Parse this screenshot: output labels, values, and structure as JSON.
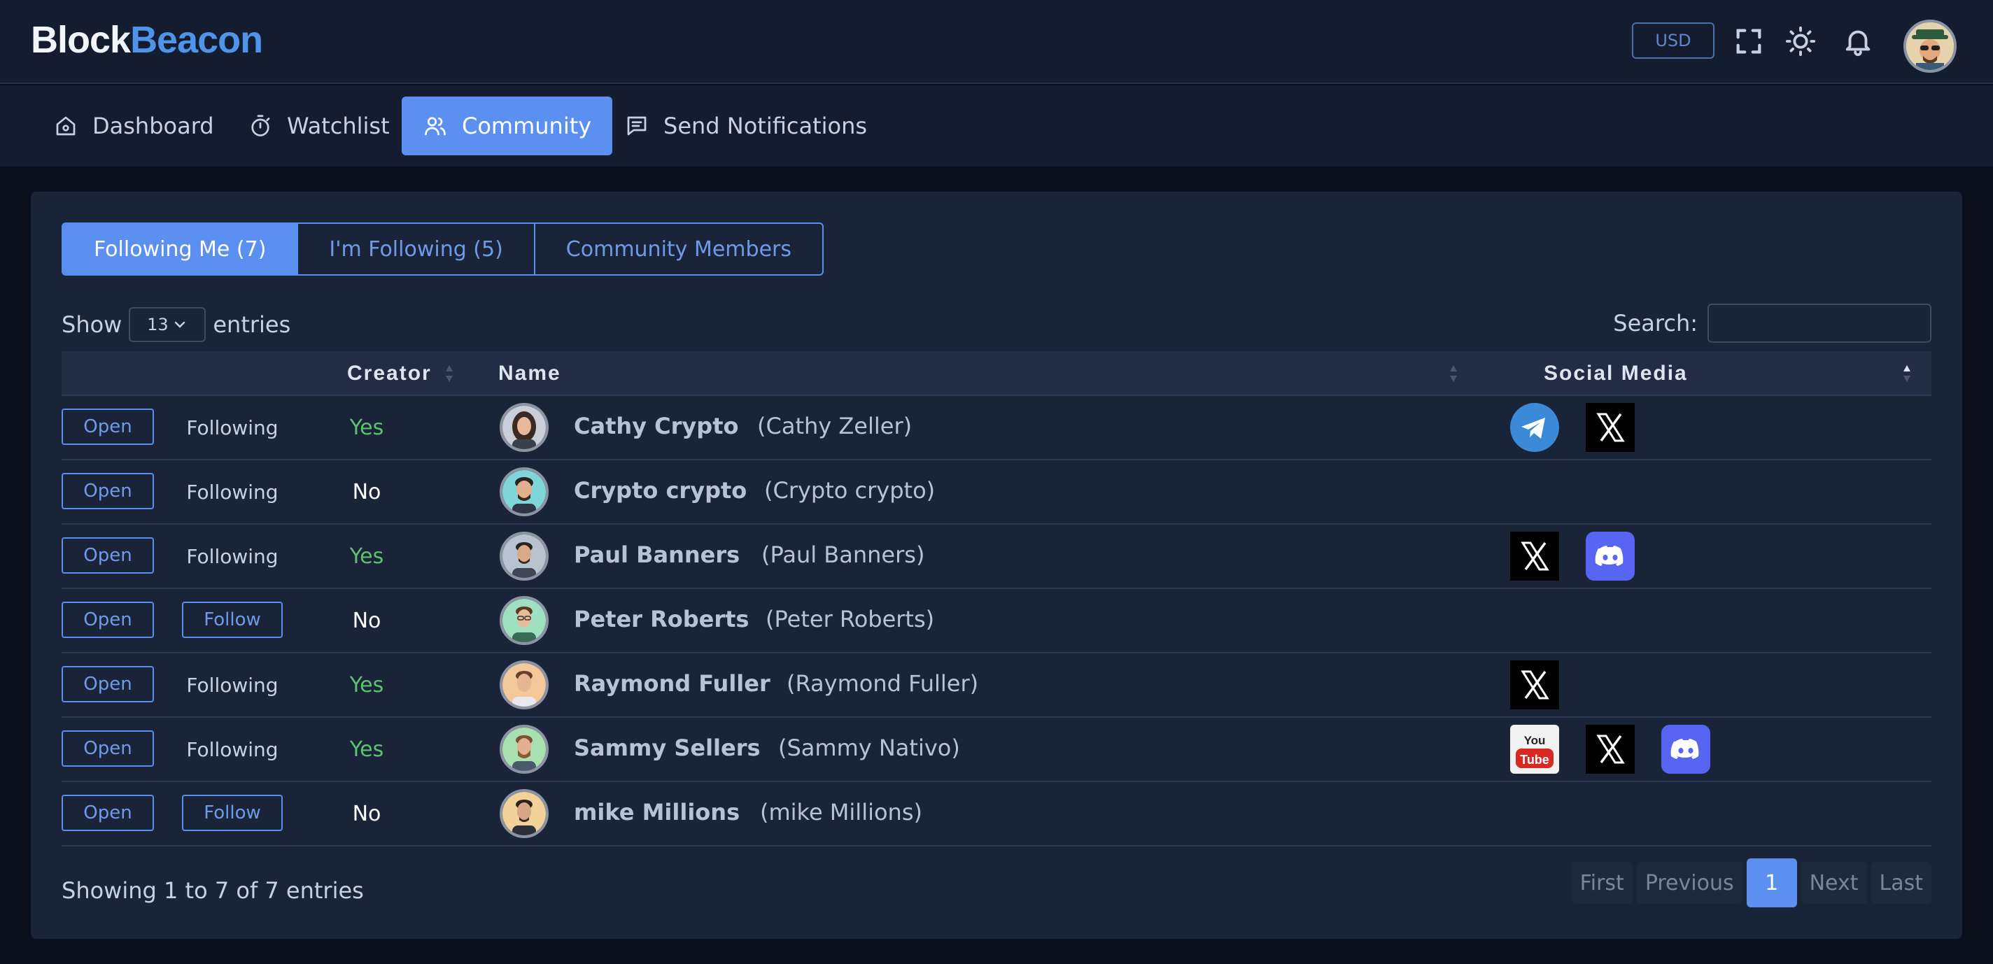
{
  "app": {
    "logo_part1": "Block",
    "logo_part2": "Beacon"
  },
  "header": {
    "currency": "USD",
    "icons": [
      "fullscreen-icon",
      "sun-icon",
      "bell-icon",
      "user-avatar"
    ]
  },
  "nav": [
    {
      "label": "Dashboard",
      "icon": "home-icon"
    },
    {
      "label": "Watchlist",
      "icon": "stopwatch-icon"
    },
    {
      "label": "Community",
      "icon": "users-icon",
      "active": true
    },
    {
      "label": "Send Notifications",
      "icon": "message-icon"
    }
  ],
  "tabs": [
    {
      "label": "Following Me (7)",
      "active": true
    },
    {
      "label": "I'm Following (5)"
    },
    {
      "label": "Community Members"
    }
  ],
  "controls": {
    "show_label": "Show",
    "entries_value": "13",
    "entries_label": "entries",
    "search_label": "Search:",
    "search_value": ""
  },
  "table": {
    "headers": {
      "creator": "Creator",
      "name": "Name",
      "social": "Social Media"
    },
    "open_label": "Open",
    "rows": [
      {
        "status": "Following",
        "creator": "Yes",
        "display": "Cathy Crypto",
        "real": "(Cathy Zeller)",
        "social": [
          "telegram",
          "x"
        ]
      },
      {
        "status": "Following",
        "creator": "No",
        "display": "Crypto crypto",
        "real": "(Crypto crypto)",
        "social": []
      },
      {
        "status": "Following",
        "creator": "Yes",
        "display": "Paul Banners",
        "real": "(Paul Banners)",
        "social": [
          "x",
          "discord"
        ]
      },
      {
        "status": "Follow",
        "creator": "No",
        "display": "Peter Roberts",
        "real": "(Peter Roberts)",
        "social": []
      },
      {
        "status": "Following",
        "creator": "Yes",
        "display": "Raymond Fuller",
        "real": "(Raymond Fuller)",
        "social": [
          "x"
        ]
      },
      {
        "status": "Following",
        "creator": "Yes",
        "display": "Sammy Sellers",
        "real": "(Sammy Nativo)",
        "social": [
          "youtube",
          "x",
          "discord"
        ]
      },
      {
        "status": "Follow",
        "creator": "No",
        "display": "mike Millions",
        "real": "(mike Millions)",
        "social": []
      }
    ]
  },
  "footer": {
    "info": "Showing 1 to 7 of 7 entries",
    "pager": {
      "first": "First",
      "previous": "Previous",
      "current": "1",
      "next": "Next",
      "last": "Last"
    }
  },
  "colors": {
    "accent": "#5b8ff0",
    "logo_blue": "#4f94e8",
    "yes": "#5cc26e",
    "card_bg": "#1a2439",
    "page_bg": "#0b101c"
  }
}
